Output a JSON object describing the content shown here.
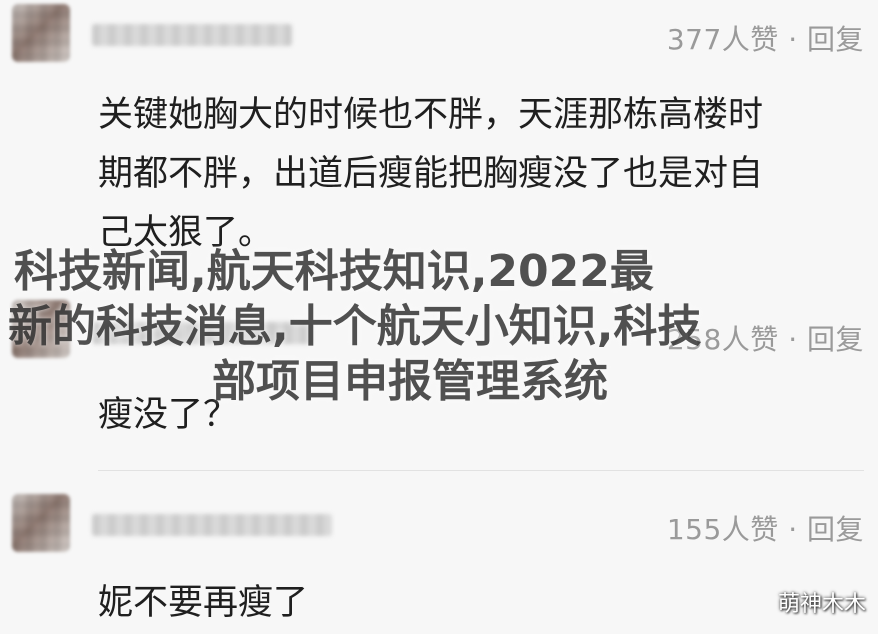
{
  "comments": [
    {
      "likes": "377人赞 · 回复",
      "lines": [
        "关键她胸大的时候也不胖，天涯那栋高楼时",
        "期都不胖，出道后瘦能把胸瘦没了也是对自",
        "己太狠了。"
      ]
    },
    {
      "likes": "258人赞 · 回复",
      "lines": [
        "瘦没了？"
      ]
    },
    {
      "likes": "155人赞 · 回复",
      "lines": [
        "妮不要再瘦了"
      ]
    }
  ],
  "overlay": {
    "line1": "科技新闻,航天科技知识,2022最",
    "line2": "新的科技消息,十个航天小知识,科技",
    "line3": "部项目申报管理系统"
  },
  "watermark": "萌神木木"
}
